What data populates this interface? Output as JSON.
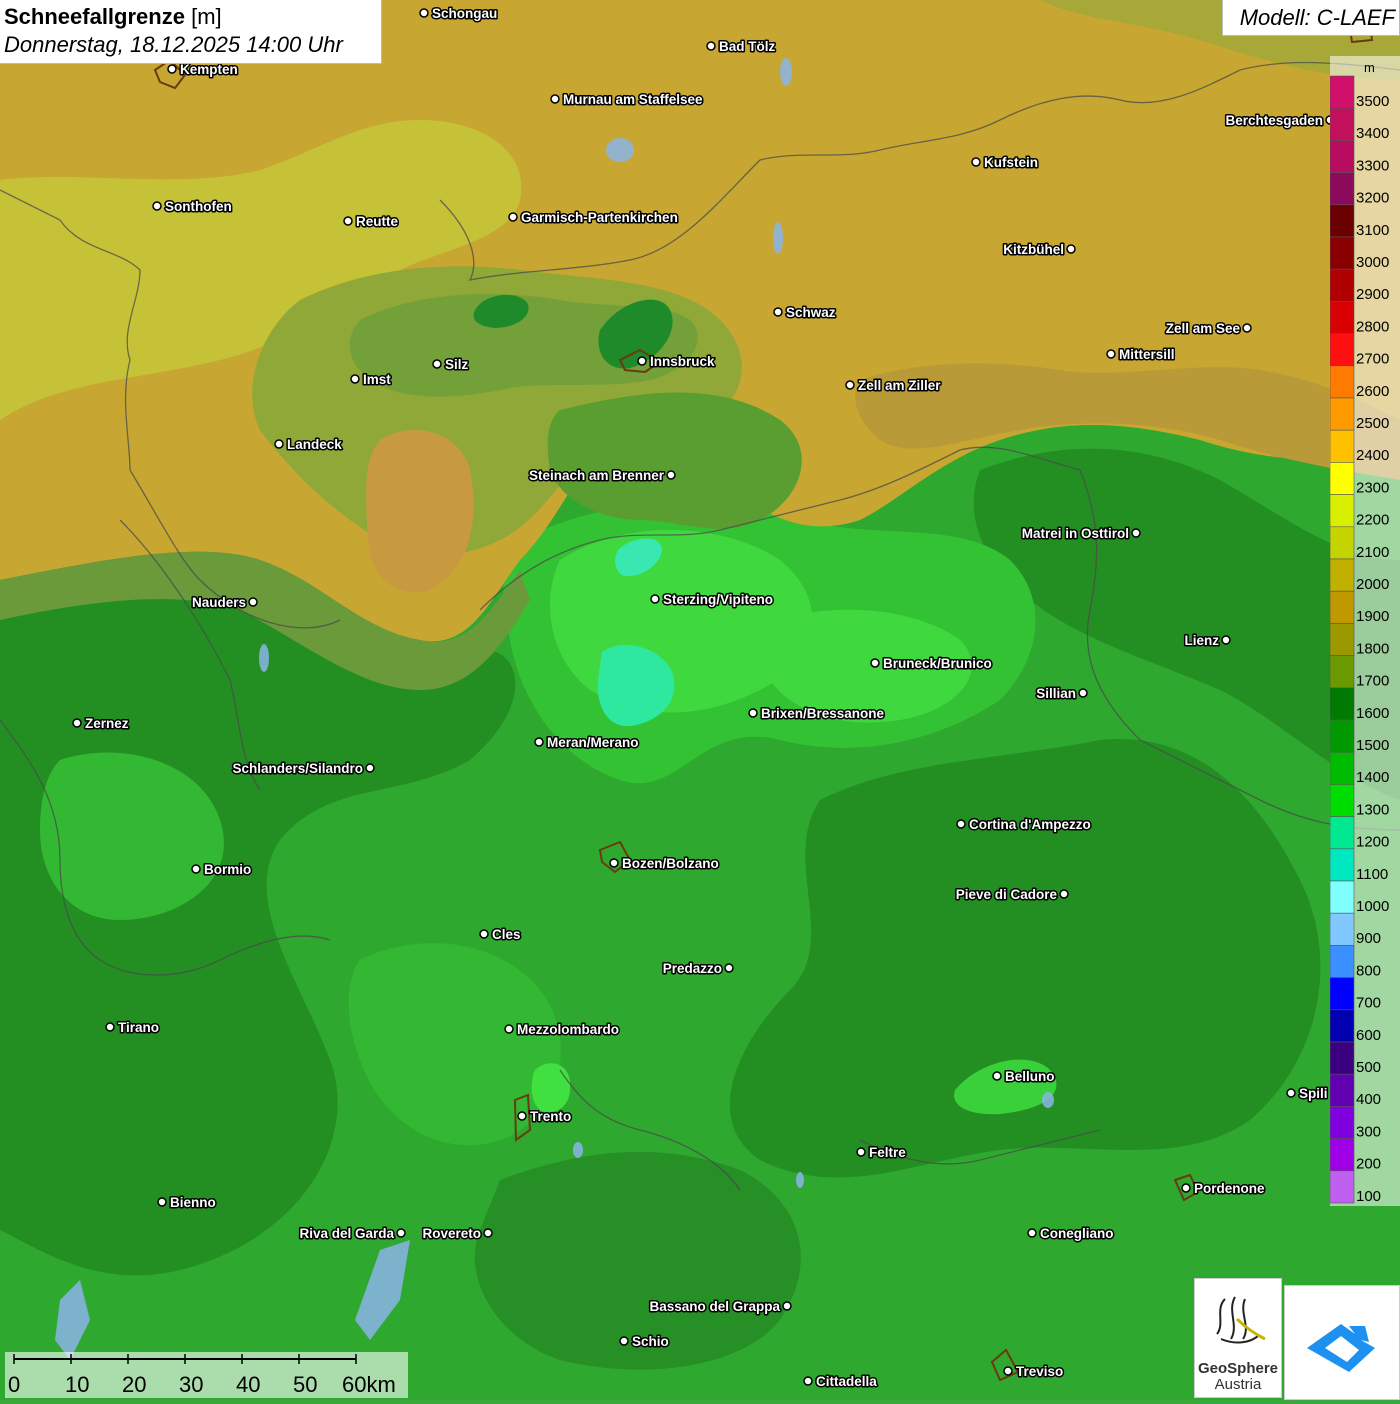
{
  "title": {
    "parameter": "Schneefallgrenze",
    "unit": "[m]",
    "datetime": "Donnerstag, 18.12.2025 14:00 Uhr"
  },
  "model": "Modell: C-LAEF",
  "legend": {
    "unit": "m",
    "levels": [
      {
        "value": "3500",
        "color": "#d0106a"
      },
      {
        "value": "3400",
        "color": "#c2105c"
      },
      {
        "value": "3300",
        "color": "#b80c60"
      },
      {
        "value": "3200",
        "color": "#8c0a5a"
      },
      {
        "value": "3100",
        "color": "#6a0000"
      },
      {
        "value": "3000",
        "color": "#8a0000"
      },
      {
        "value": "2900",
        "color": "#b00000"
      },
      {
        "value": "2800",
        "color": "#d80000"
      },
      {
        "value": "2700",
        "color": "#ff1010"
      },
      {
        "value": "2600",
        "color": "#ff7a00"
      },
      {
        "value": "2500",
        "color": "#ff9a00"
      },
      {
        "value": "2400",
        "color": "#ffc000"
      },
      {
        "value": "2300",
        "color": "#ffff00"
      },
      {
        "value": "2200",
        "color": "#d8f000"
      },
      {
        "value": "2100",
        "color": "#c4d400"
      },
      {
        "value": "2000",
        "color": "#c0b000"
      },
      {
        "value": "1900",
        "color": "#c09800"
      },
      {
        "value": "1800",
        "color": "#9a9a00"
      },
      {
        "value": "1700",
        "color": "#6a9a00"
      },
      {
        "value": "1600",
        "color": "#007a00"
      },
      {
        "value": "1500",
        "color": "#009a00"
      },
      {
        "value": "1400",
        "color": "#00bb00"
      },
      {
        "value": "1300",
        "color": "#00dd00"
      },
      {
        "value": "1200",
        "color": "#00e890"
      },
      {
        "value": "1100",
        "color": "#00e8c0"
      },
      {
        "value": "1000",
        "color": "#80ffff"
      },
      {
        "value": "900",
        "color": "#80c8ff"
      },
      {
        "value": "800",
        "color": "#3a90ff"
      },
      {
        "value": "700",
        "color": "#0000ff"
      },
      {
        "value": "600",
        "color": "#0000b0"
      },
      {
        "value": "500",
        "color": "#3a0080"
      },
      {
        "value": "400",
        "color": "#6000b0"
      },
      {
        "value": "300",
        "color": "#8000e0"
      },
      {
        "value": "200",
        "color": "#a000e8"
      },
      {
        "value": "100",
        "color": "#c060f0"
      }
    ]
  },
  "cities": [
    {
      "name": "Schongau",
      "label_side": "right"
    },
    {
      "name": "Bad Tölz",
      "label_side": "right"
    },
    {
      "name": "Kempten",
      "label_side": "right"
    },
    {
      "name": "Murnau am Staffelsee",
      "label_side": "right"
    },
    {
      "name": "Berchtesgaden",
      "label_side": "left"
    },
    {
      "name": "Kufstein",
      "label_side": "right"
    },
    {
      "name": "Sonthofen",
      "label_side": "right"
    },
    {
      "name": "Reutte",
      "label_side": "right"
    },
    {
      "name": "Garmisch-Partenkirchen",
      "label_side": "right"
    },
    {
      "name": "Kitzbühel",
      "label_side": "left"
    },
    {
      "name": "Schwaz",
      "label_side": "right"
    },
    {
      "name": "Zell am See",
      "label_side": "left"
    },
    {
      "name": "Innsbruck",
      "label_side": "right"
    },
    {
      "name": "Mittersill",
      "label_side": "right"
    },
    {
      "name": "Silz",
      "label_side": "right"
    },
    {
      "name": "Imst",
      "label_side": "right"
    },
    {
      "name": "Zell am Ziller",
      "label_side": "right"
    },
    {
      "name": "Landeck",
      "label_side": "right"
    },
    {
      "name": "Steinach am Brenner",
      "label_side": "left"
    },
    {
      "name": "Matrei in Osttirol",
      "label_side": "left"
    },
    {
      "name": "Nauders",
      "label_side": "left"
    },
    {
      "name": "Sterzing/Vipiteno",
      "label_side": "right"
    },
    {
      "name": "Lienz",
      "label_side": "left"
    },
    {
      "name": "Bruneck/Brunico",
      "label_side": "right"
    },
    {
      "name": "Sillian",
      "label_side": "left"
    },
    {
      "name": "Brixen/Bressanone",
      "label_side": "right"
    },
    {
      "name": "Zernez",
      "label_side": "right"
    },
    {
      "name": "Meran/Merano",
      "label_side": "right"
    },
    {
      "name": "Schlanders/Silandro",
      "label_side": "left"
    },
    {
      "name": "Cortina d'Ampezzo",
      "label_side": "right"
    },
    {
      "name": "Bozen/Bolzano",
      "label_side": "right"
    },
    {
      "name": "Bormio",
      "label_side": "right"
    },
    {
      "name": "Pieve di Cadore",
      "label_side": "left"
    },
    {
      "name": "Cles",
      "label_side": "right"
    },
    {
      "name": "Predazzo",
      "label_side": "left"
    },
    {
      "name": "Tirano",
      "label_side": "right"
    },
    {
      "name": "Mezzolombardo",
      "label_side": "right"
    },
    {
      "name": "Belluno",
      "label_side": "right"
    },
    {
      "name": "Spili",
      "label_side": "right"
    },
    {
      "name": "Trento",
      "label_side": "right"
    },
    {
      "name": "Feltre",
      "label_side": "right"
    },
    {
      "name": "Pordenone",
      "label_side": "right"
    },
    {
      "name": "Bienno",
      "label_side": "right"
    },
    {
      "name": "Riva del Garda",
      "label_side": "left"
    },
    {
      "name": "Rovereto",
      "label_side": "left"
    },
    {
      "name": "Conegliano",
      "label_side": "right"
    },
    {
      "name": "Bassano del Grappa",
      "label_side": "left"
    },
    {
      "name": "Schio",
      "label_side": "right"
    },
    {
      "name": "Treviso",
      "label_side": "right"
    },
    {
      "name": "Cittadella",
      "label_side": "right"
    }
  ],
  "scalebar": {
    "labels": [
      "0",
      "10",
      "20",
      "30",
      "40",
      "50",
      "60km"
    ]
  },
  "logos": {
    "geosphere_line1": "GeoSphere",
    "geosphere_line2": "Austria"
  }
}
